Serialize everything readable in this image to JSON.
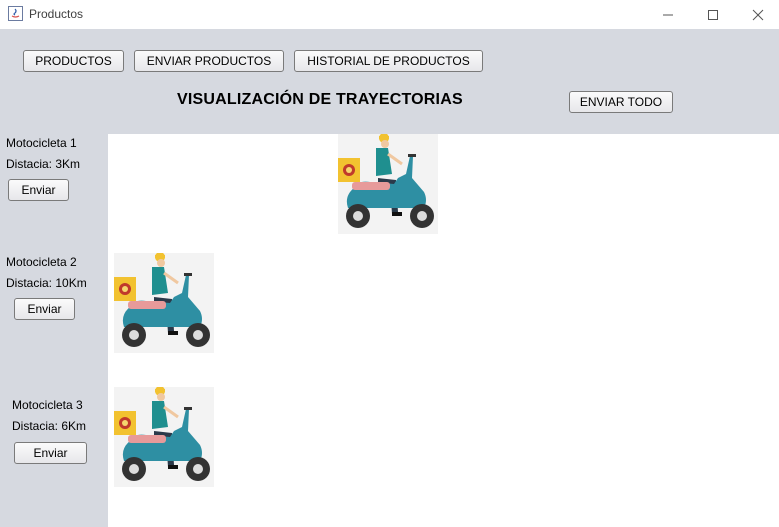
{
  "window": {
    "title": "Productos",
    "icons": {
      "app": "java-icon",
      "minimize": "minimize-icon",
      "maximize": "maximize-icon",
      "close": "close-icon"
    }
  },
  "toolbar": {
    "productos_label": "PRODUCTOS",
    "enviar_productos_label": "ENVIAR PRODUCTOS",
    "historial_label": "HISTORIAL DE PRODUCTOS",
    "enviar_todo_label": "ENVIAR TODO"
  },
  "page": {
    "heading": "VISUALIZACIÓN DE TRAYECTORIAS"
  },
  "motorcycles": [
    {
      "name": "Motocicleta 1",
      "distance": "Distacia: 3Km",
      "button": "Enviar"
    },
    {
      "name": "Motocicleta 2",
      "distance": "Distacia: 10Km",
      "button": "Enviar"
    },
    {
      "name": "Motocicleta 3",
      "distance": "Distacia: 6Km",
      "button": "Enviar"
    }
  ],
  "colors": {
    "window_bg": "#d6d9e0",
    "panel_bg": "#ffffff",
    "scooter_body": "#2e8fa3",
    "scooter_seat": "#e79a9a",
    "delivery_box": "#f2c230",
    "rider_helmet": "#f2c230"
  }
}
